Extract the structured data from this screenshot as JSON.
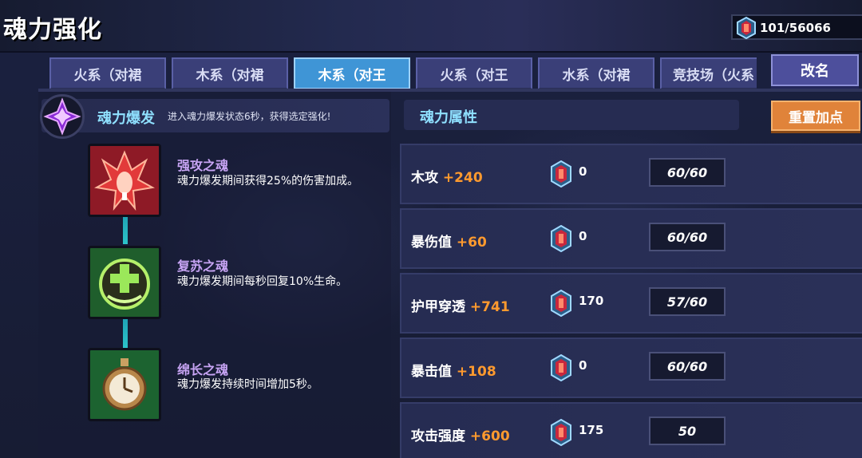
{
  "header": {
    "title": "魂力强化",
    "currency": {
      "icon": "soul-gem-icon",
      "value": "101/56066"
    }
  },
  "tabs": [
    {
      "label": "火系（对裙",
      "active": false
    },
    {
      "label": "木系（对裙",
      "active": false
    },
    {
      "label": "木系（对王",
      "active": true
    },
    {
      "label": "火系（对王",
      "active": false
    },
    {
      "label": "水系（对裙",
      "active": false
    },
    {
      "label": "竞技场（火系",
      "active": false
    }
  ],
  "buttons": {
    "rename": "改名",
    "reset": "重置加点"
  },
  "soul_burst": {
    "icon": "purple-crystal-icon",
    "title": "魂力爆发",
    "description": "进入魂力爆发状态6秒，获得选定强化!"
  },
  "skills": [
    {
      "icon": "red-flame-creature-icon",
      "name": "强攻之魂",
      "description": "魂力爆发期间获得25%的伤害加成。"
    },
    {
      "icon": "green-heal-cross-icon",
      "name": "复苏之魂",
      "description": "魂力爆发期间每秒回复10%生命。"
    },
    {
      "icon": "pocket-watch-icon",
      "name": "绵长之魂",
      "description": "魂力爆发持续时间增加5秒。"
    }
  ],
  "attributes_panel": {
    "title": "魂力属性",
    "rows": [
      {
        "name": "木攻",
        "bonus": "+240",
        "cost": "0",
        "level": "60/60"
      },
      {
        "name": "暴伤值",
        "bonus": "+60",
        "cost": "0",
        "level": "60/60"
      },
      {
        "name": "护甲穿透",
        "bonus": "+741",
        "cost": "170",
        "level": "57/60"
      },
      {
        "name": "暴击值",
        "bonus": "+108",
        "cost": "0",
        "level": "60/60"
      },
      {
        "name": "攻击强度",
        "bonus": "+600",
        "cost": "175",
        "level": "50"
      }
    ]
  },
  "colors": {
    "accent_cyan": "#8fe0ff",
    "bonus_orange": "#ff9a2e",
    "skill_name_purple": "#c7a4f4",
    "active_tab": "#3f95d6",
    "reset_button": "#e0833a"
  }
}
